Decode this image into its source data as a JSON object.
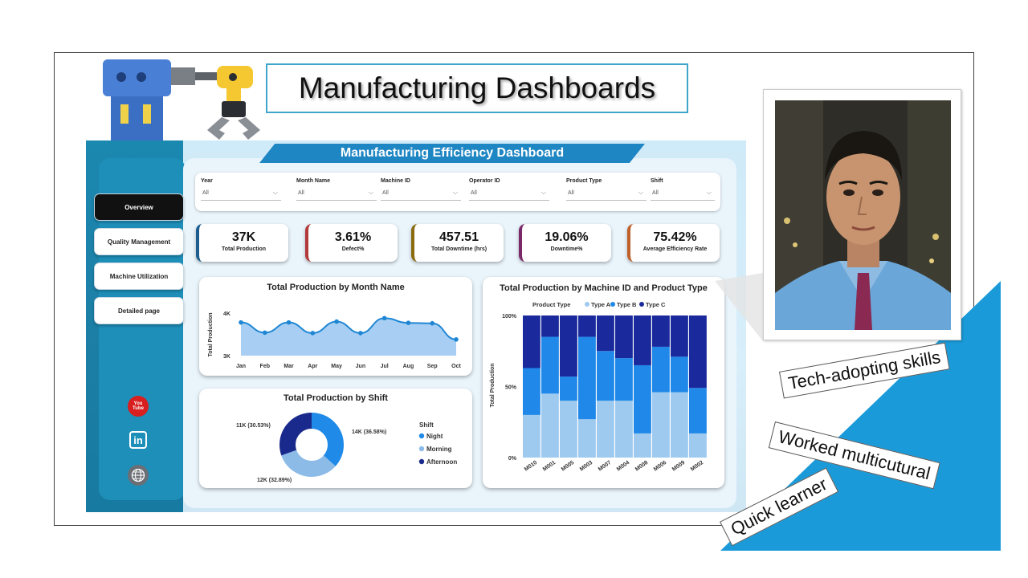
{
  "slide": {
    "title": "Manufacturing Dashboards"
  },
  "dashboard": {
    "title": "Manufacturing Efficiency Dashboard",
    "nav": [
      {
        "label": "Overview",
        "active": true
      },
      {
        "label": "Quality Management",
        "active": false
      },
      {
        "label": "Machine Utilization",
        "active": false
      },
      {
        "label": "Detailed page",
        "active": false
      }
    ],
    "filters": [
      {
        "label": "Year",
        "value": "All"
      },
      {
        "label": "Month Name",
        "value": "All"
      },
      {
        "label": "Machine ID",
        "value": "All"
      },
      {
        "label": "Operator ID",
        "value": "All"
      },
      {
        "label": "Product Type",
        "value": "All"
      },
      {
        "label": "Shift",
        "value": "All"
      }
    ],
    "kpis": [
      {
        "value": "37K",
        "label": "Total Production",
        "color": "#1b5e8f"
      },
      {
        "value": "3.61%",
        "label": "Defect%",
        "color": "#b23a3a"
      },
      {
        "value": "457.51",
        "label": "Total Downtime (hrs)",
        "color": "#8a6b10"
      },
      {
        "value": "19.06%",
        "label": "Downtime%",
        "color": "#7a2a6a"
      },
      {
        "value": "75.42%",
        "label": "Average Efficiency Rate",
        "color": "#c0612a"
      }
    ],
    "social_icons": [
      "youtube-icon",
      "linkedin-icon",
      "globe-icon"
    ],
    "social_youtube_text": "You Tube",
    "social_linkedin_text": "in"
  },
  "chart_data": [
    {
      "type": "area",
      "title": "Total Production by Month Name",
      "xlabel": "",
      "ylabel": "Total Production",
      "categories": [
        "Jan",
        "Feb",
        "Mar",
        "Apr",
        "May",
        "Jun",
        "Jul",
        "Aug",
        "Sep",
        "Oct"
      ],
      "values": [
        3780,
        3540,
        3780,
        3530,
        3800,
        3530,
        3880,
        3770,
        3760,
        3380
      ],
      "yticks": [
        "3K",
        "4K"
      ],
      "ylim": [
        3000,
        4000
      ],
      "color": "#1f86d4"
    },
    {
      "type": "pie",
      "title": "Total Production by Shift",
      "legend_title": "Shift",
      "slices": [
        {
          "name": "Night",
          "value": 36.58,
          "label": "14K (36.58%)",
          "color": "#1f8ae8"
        },
        {
          "name": "Morning",
          "value": 32.89,
          "label": "12K (32.89%)",
          "color": "#8cbbe8"
        },
        {
          "name": "Afternoon",
          "value": 30.53,
          "label": "11K (30.53%)",
          "color": "#1a2a8c"
        }
      ]
    },
    {
      "type": "bar",
      "stacked": true,
      "percent": true,
      "title": "Total Production by Machine ID and Product Type",
      "legend_title": "Product Type",
      "ylabel": "Total Production",
      "yticks": [
        "0%",
        "50%",
        "100%"
      ],
      "categories": [
        "M010",
        "M001",
        "M005",
        "M003",
        "M007",
        "M004",
        "M008",
        "M006",
        "M009",
        "M002"
      ],
      "series": [
        {
          "name": "Type A",
          "color": "#9fcaf0",
          "values": [
            30,
            45,
            40,
            27,
            40,
            40,
            17,
            46,
            46,
            17
          ]
        },
        {
          "name": "Type B",
          "color": "#1f88e8",
          "values": [
            33,
            40,
            17,
            58,
            35,
            30,
            48,
            32,
            25,
            32
          ]
        },
        {
          "name": "Type C",
          "color": "#1a2a9c",
          "values": [
            37,
            15,
            43,
            15,
            25,
            30,
            35,
            22,
            29,
            51
          ]
        }
      ]
    }
  ],
  "tags": [
    {
      "text": "Tech-adopting skills"
    },
    {
      "text": "Worked multicutural"
    },
    {
      "text": "Quick learner"
    }
  ],
  "colors": {
    "accent": "#1a9ad8",
    "title_border": "#3fa6c9"
  }
}
